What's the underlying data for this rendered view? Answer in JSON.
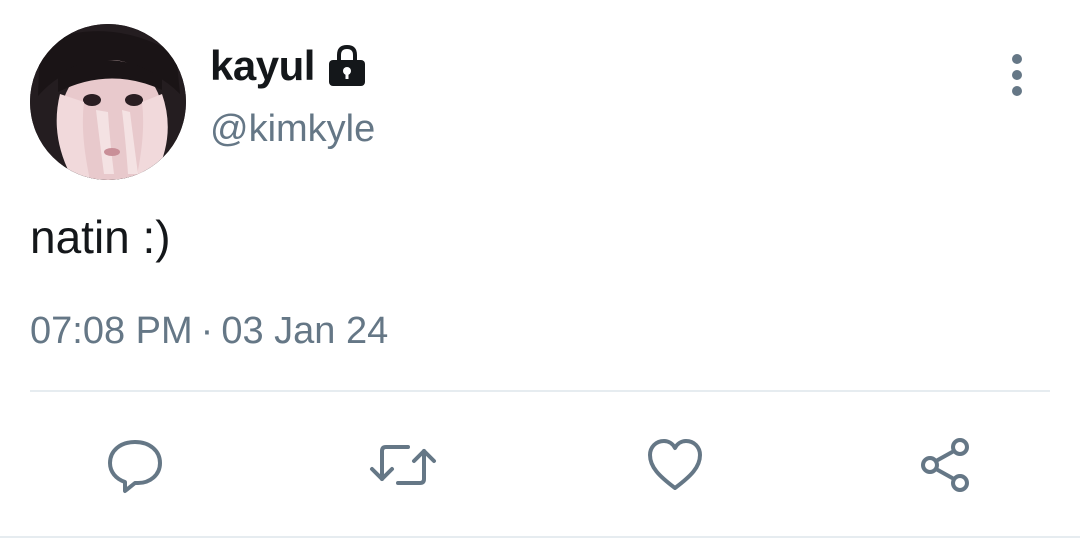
{
  "tweet": {
    "author": {
      "display_name": "kayul",
      "handle": "@kimkyle",
      "protected_icon": "lock-icon",
      "avatar": "user-avatar-photo"
    },
    "more_icon": "more-vertical-icon",
    "text": "natin :)",
    "time": "07:08 PM",
    "separator": "·",
    "date": "03 Jan 24"
  },
  "actions": [
    {
      "name": "reply",
      "icon": "reply-icon"
    },
    {
      "name": "retweet",
      "icon": "retweet-icon"
    },
    {
      "name": "like",
      "icon": "heart-icon"
    },
    {
      "name": "share",
      "icon": "share-icon"
    }
  ],
  "colors": {
    "text_primary": "#14171a",
    "text_secondary": "#657786",
    "divider": "#e6ecf0",
    "background": "#ffffff"
  }
}
